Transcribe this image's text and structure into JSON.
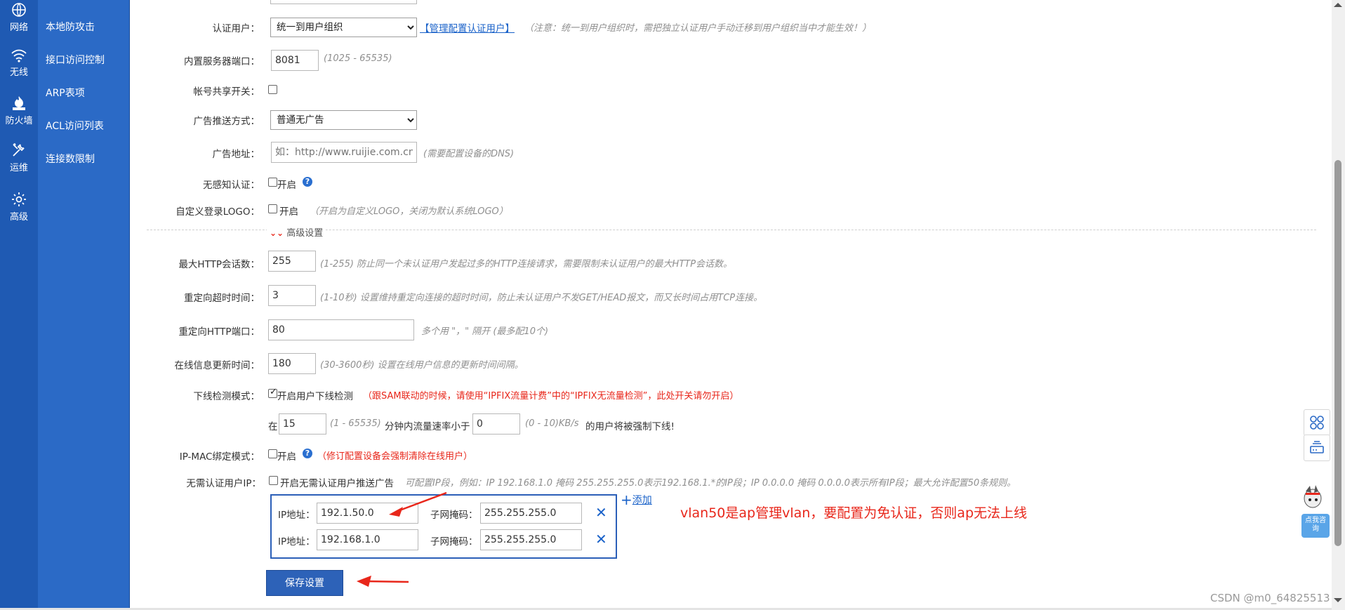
{
  "rail": [
    {
      "label": "网络",
      "icon": "globe-icon"
    },
    {
      "label": "无线",
      "icon": "wifi-icon"
    },
    {
      "label": "防火墙",
      "icon": "firewall-icon"
    },
    {
      "label": "运维",
      "icon": "tools-icon"
    },
    {
      "label": "高级",
      "icon": "gear-icon"
    }
  ],
  "submenu": [
    "本地防攻击",
    "接口访问控制",
    "ARP表项",
    "ACL访问列表",
    "连接数限制"
  ],
  "form": {
    "auth_user": {
      "label": "认证用户：",
      "selected": "统一到用户组织",
      "link": "【管理配置认证用户】",
      "hint": "（注意：统一到用户组织时，需把独立认证用户手动迁移到用户组织当中才能生效！）"
    },
    "server_port": {
      "label": "内置服务器端口：",
      "value": "8081",
      "hint": "(1025 - 65535)"
    },
    "account_share": {
      "label": "帐号共享开关："
    },
    "ad_mode": {
      "label": "广告推送方式：",
      "selected": "普通无广告"
    },
    "ad_url": {
      "label": "广告地址：",
      "placeholder": "如：http://www.ruijie.com.cn",
      "hint": "(需要配置设备的DNS)"
    },
    "seamless": {
      "label": "无感知认证：",
      "text": "开启"
    },
    "custom_logo": {
      "label": "自定义登录LOGO：",
      "text": "开启",
      "hint": "（开启为自定义LOGO，关闭为默认系统LOGO）"
    },
    "advanced_toggle": "高级设置",
    "max_http": {
      "label": "最大HTTP会话数：",
      "value": "255",
      "hint": "(1-255)   防止同一个未认证用户发起过多的HTTP连接请求，需要限制未认证用户的最大HTTP会话数。"
    },
    "redirect_timeout": {
      "label": "重定向超时时间：",
      "value": "3",
      "hint": "(1-10秒)   设置维持重定向连接的超时时间，防止未认证用户不发GET/HEAD报文，而又长时间占用TCP连接。"
    },
    "redirect_port": {
      "label": "重定向HTTP端口：",
      "value": "80",
      "hint": "多个用 \"，\" 隔开    (最多配10个)"
    },
    "online_update": {
      "label": "在线信息更新时间：",
      "value": "180",
      "hint": "(30-3600秒)   设置在线用户信息的更新时间间隔。"
    },
    "offline_detect": {
      "label": "下线检测模式：",
      "text": "开启用户下线检测",
      "warning": "（跟SAM联动的时候，请使用“IPFIX流量计费”中的“IPFIX无流量检测”，此处开关请勿开启）",
      "prefix": "在",
      "minutes": "15",
      "minutes_hint": "(1 - 65535)",
      "mid_text": "分钟内流量速率小于",
      "rate": "0",
      "rate_hint": "(0 - 10)KB/s",
      "suffix": "的用户将被强制下线!"
    },
    "ip_mac": {
      "label": "IP-MAC绑定模式：",
      "text": "开启",
      "warning": "（修订配置设备会强制清除在线用户）"
    },
    "free_auth": {
      "label": "无需认证用户IP：",
      "text": "开启无需认证用户推送广告",
      "hint": "可配置IP段，例如：IP 192.168.1.0 掩码 255.255.255.0表示192.168.1.*的IP段；IP 0.0.0.0 掩码 0.0.0.0表示所有IP段；最大允许配置50条规则。",
      "add_label": "添加",
      "rows": [
        {
          "ip_label": "IP地址：",
          "ip": "192.1.50.0",
          "mask_label": "子网掩码：",
          "mask": "255.255.255.0"
        },
        {
          "ip_label": "IP地址：",
          "ip": "192.168.1.0",
          "mask_label": "子网掩码：",
          "mask": "255.255.255.0"
        }
      ]
    },
    "save_label": "保存设置"
  },
  "annotation": "vlan50是ap管理vlan，要配置为免认证，否则ap无法上线",
  "mascot_text": "点我咨询",
  "watermark": "CSDN @m0_64825513",
  "colors": {
    "rail": "#1f5ab3",
    "submenu": "#2b6ac6",
    "accent": "#2d62b8",
    "warning": "#e8271b"
  }
}
